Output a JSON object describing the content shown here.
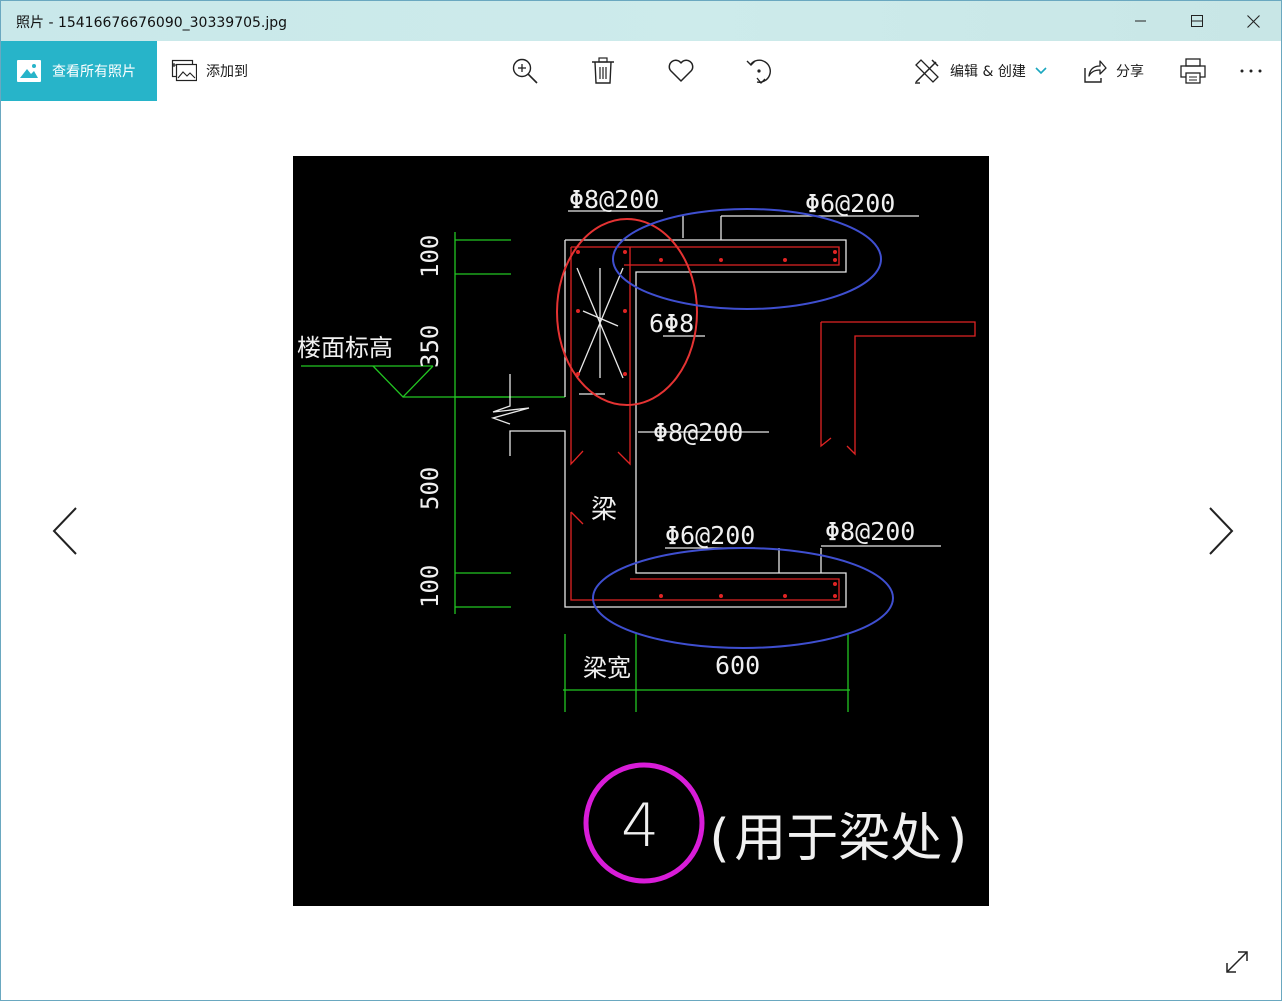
{
  "window": {
    "title": "照片 - 15416676676090_30339705.jpg"
  },
  "toolbar": {
    "view_all_label": "查看所有照片",
    "add_to_label": "添加到",
    "edit_create_label": "编辑 & 创建",
    "share_label": "分享"
  },
  "icons": {
    "zoom": "zoom-in-icon",
    "delete": "trash-icon",
    "favorite": "heart-icon",
    "rotate": "rotate-icon",
    "print": "printer-icon",
    "more": "more-icon"
  },
  "colors": {
    "accent": "#27b4c9",
    "titlebar": "#cbe9ea"
  },
  "drawing": {
    "labels": {
      "top_left": "Φ8@200",
      "top_right": "Φ6@200",
      "middle": "6Φ8",
      "mid_right": "Φ8@200",
      "bottom_left": "Φ6@200",
      "bottom_right": "Φ8@200",
      "floor_level": "楼面标高",
      "beam": "梁",
      "beam_width": "梁宽",
      "dim_600": "600",
      "dim_100_top": "100",
      "dim_350": "350",
      "dim_500": "500",
      "dim_100_bottom": "100",
      "detail_number": "4",
      "detail_caption": "(用于梁处)"
    }
  }
}
